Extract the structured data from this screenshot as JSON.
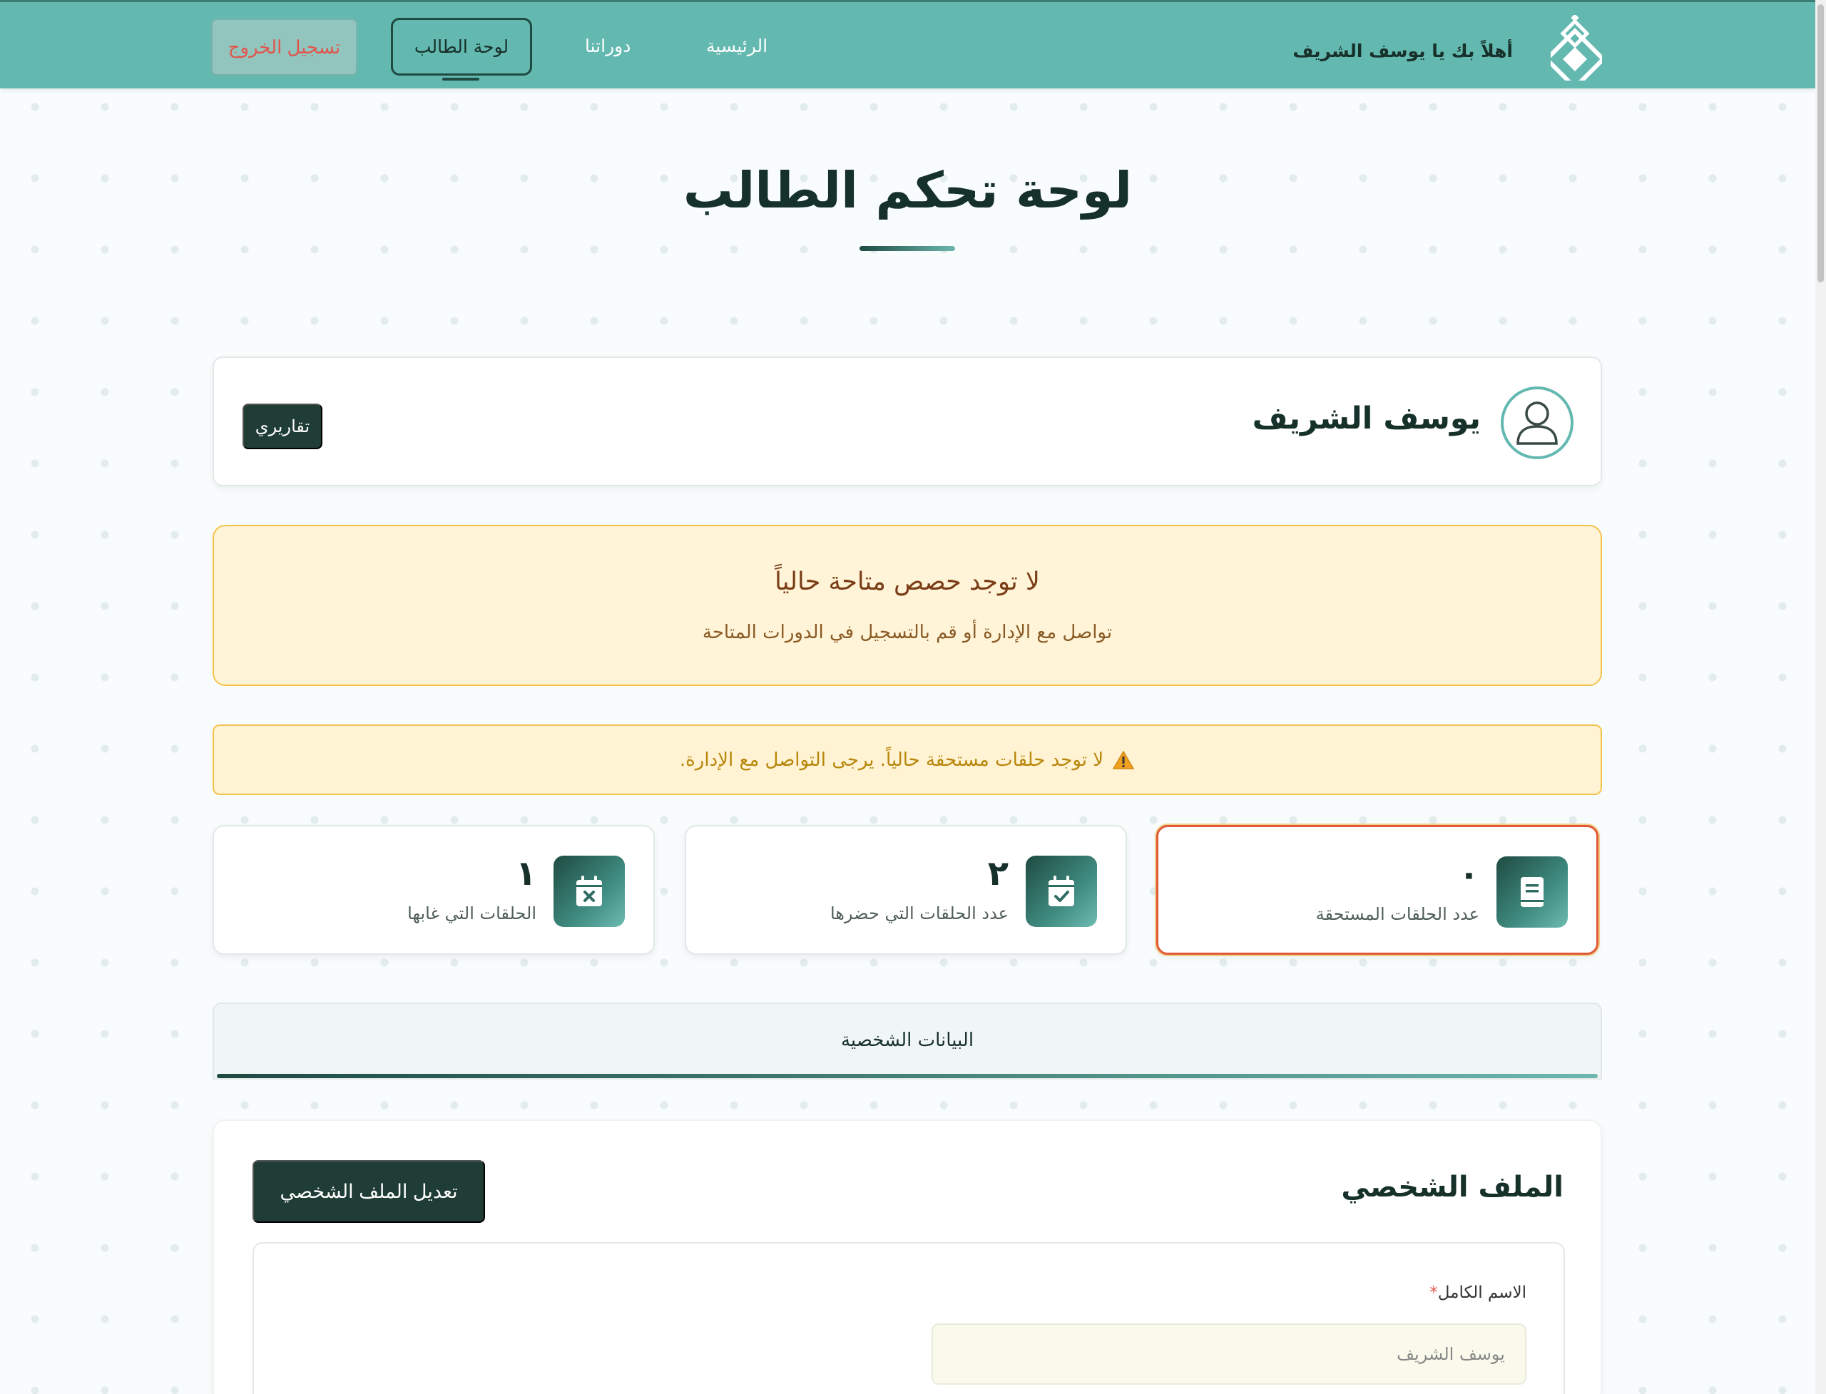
{
  "navbar": {
    "welcome": "أهلاً بك يا يوسف الشريف",
    "links": {
      "home": "الرئيسية",
      "courses": "دوراتنا",
      "dashboard": "لوحة الطالب"
    },
    "logout": "تسجيل الخروج"
  },
  "page": {
    "title": "لوحة تحكم الطالب"
  },
  "profile_card": {
    "name": "يوسف الشريف",
    "reports_button": "تقاريري"
  },
  "alerts": {
    "no_sessions_title": "لا توجد حصص متاحة حالياً",
    "no_sessions_sub": "تواصل مع الإدارة أو قم بالتسجيل في الدورات المتاحة",
    "no_due_sessions": "لا توجد حلقات مستحقة حالياً. يرجى التواصل مع الإدارة."
  },
  "stats": {
    "due": {
      "value": "٠",
      "label": "عدد الحلقات المستحقة",
      "icon": "book-icon"
    },
    "attended": {
      "value": "٢",
      "label": "عدد الحلقات التي حضرها",
      "icon": "calendar-check-icon"
    },
    "absent": {
      "value": "١",
      "label": "الحلقات التي غابها",
      "icon": "calendar-x-icon"
    }
  },
  "tabs": {
    "personal_data": "البيانات الشخصية"
  },
  "profile_panel": {
    "title": "الملف الشخصي",
    "edit_button": "تعديل الملف الشخصي",
    "full_name_label": "الاسم الكامل",
    "required_mark": "*",
    "full_name_placeholder": "يوسف الشريف"
  },
  "colors": {
    "navbar": "#63b8b0",
    "primary_dark": "#1f3c35",
    "accent_teal": "#6cb7ae",
    "logout_text": "#e0564d",
    "alert_bg": "#fff4d8",
    "alert_border": "#f4c34c",
    "due_card_border": "#e05a3a"
  }
}
